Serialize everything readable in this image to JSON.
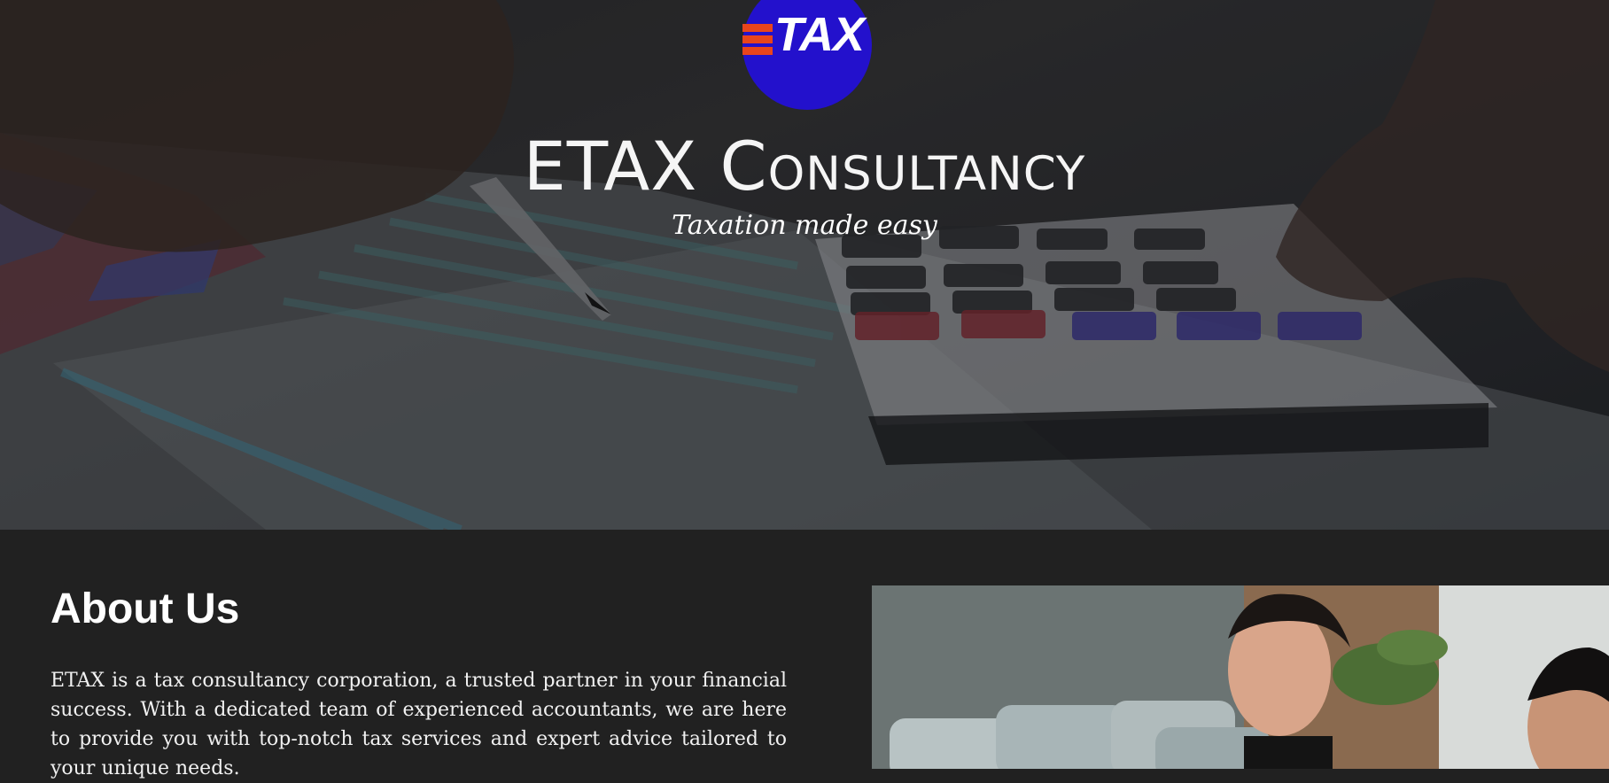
{
  "brand": {
    "logo_text": "TAX",
    "logo_colors": {
      "circle": "#2311cc",
      "bars": "#e8451c",
      "text": "#ffffff"
    }
  },
  "hero": {
    "title": "ETAX Consultancy",
    "tagline": "Taxation made easy",
    "background_icon": "calculator-and-spreadsheet-photo"
  },
  "about": {
    "heading": "About Us",
    "paragraph": "ETAX is a tax consultancy corporation, a trusted partner in your financial success. With a dedicated team of experienced accountants, we are here to provide you with top-notch tax services and expert advice tailored to your unique needs.",
    "image_icon": "team-meeting-photo"
  },
  "colors": {
    "page_background": "#212121",
    "text": "#ffffff"
  }
}
